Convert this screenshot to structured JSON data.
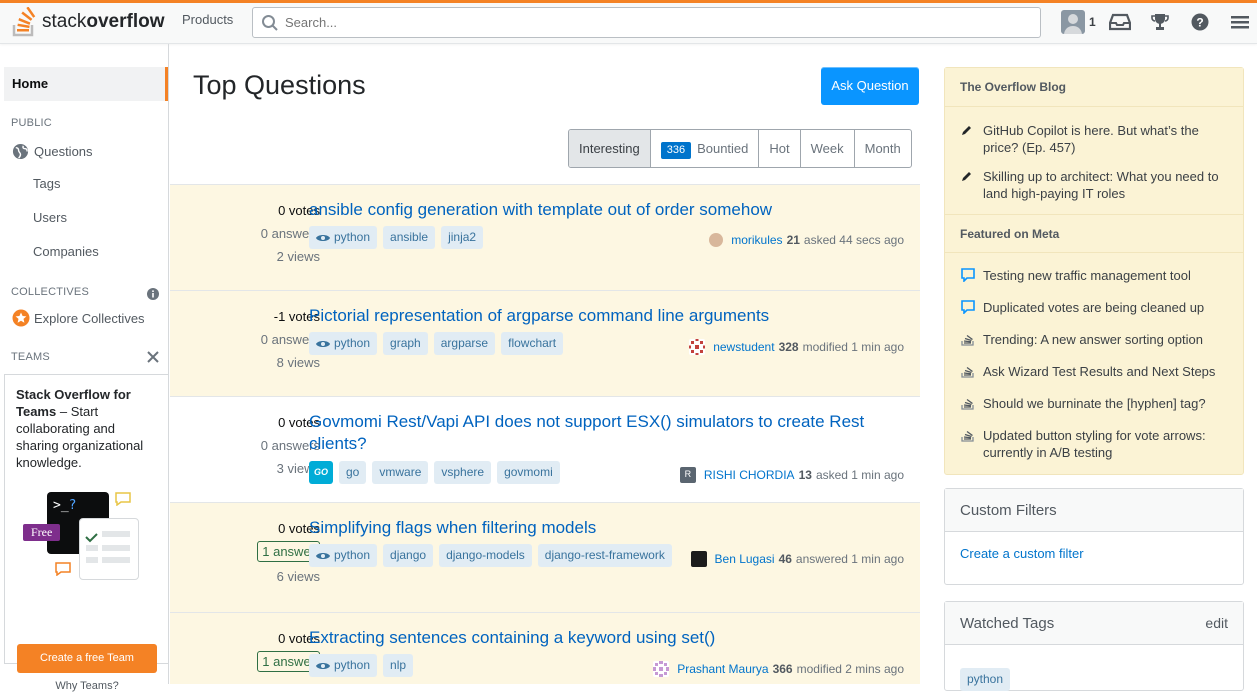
{
  "header": {
    "logo_text_light": "stack",
    "logo_text_bold": "overflow",
    "products": "Products",
    "search_placeholder": "Search...",
    "reputation": "1"
  },
  "sidebar": {
    "home": "Home",
    "public": "PUBLIC",
    "questions": "Questions",
    "tags": "Tags",
    "users": "Users",
    "companies": "Companies",
    "collectives": "COLLECTIVES",
    "explore_collectives": "Explore Collectives",
    "teams": "TEAMS",
    "teams_title": "Stack Overflow for Teams",
    "teams_desc": " – Start collaborating and sharing organizational knowledge.",
    "free_badge": "Free",
    "create_team": "Create a free Team",
    "why_teams": "Why Teams?"
  },
  "main": {
    "title": "Top Questions",
    "ask_button": "Ask Question",
    "filters": [
      {
        "label": "Interesting"
      },
      {
        "label": "Bountied",
        "badge": "336"
      },
      {
        "label": "Hot"
      },
      {
        "label": "Week"
      },
      {
        "label": "Month"
      }
    ],
    "questions": [
      {
        "votes": "0 votes",
        "answers": "0 answers",
        "views": "2 views",
        "title": "ansible config generation with template out of order somehow",
        "tags": [
          "python",
          "ansible",
          "jinja2"
        ],
        "user": "morikules",
        "rep": "21",
        "action": "asked 44 secs ago"
      },
      {
        "votes": "-1 votes",
        "answers": "0 answers",
        "views": "8 views",
        "title": "Pictorial representation of argparse command line arguments",
        "tags": [
          "python",
          "graph",
          "argparse",
          "flowchart"
        ],
        "user": "newstudent",
        "rep": "328",
        "action": "modified 1 min ago"
      },
      {
        "votes": "0 votes",
        "answers": "0 answers",
        "views": "3 views",
        "title": "Govmomi Rest/Vapi API does not support ESX() simulators to create Rest clients?",
        "tags": [
          "go",
          "vmware",
          "vsphere",
          "govmomi"
        ],
        "user": "RISHI CHORDIA",
        "rep": "13",
        "action": "asked 1 min ago",
        "avatar_letter": "R"
      },
      {
        "votes": "0 votes",
        "answers": "1 answer",
        "views": "6 views",
        "title": "Simplifying flags when filtering models",
        "tags": [
          "python",
          "django",
          "django-models",
          "django-rest-framework"
        ],
        "user": "Ben Lugasi",
        "rep": "46",
        "action": "answered 1 min ago"
      },
      {
        "votes": "0 votes",
        "answers": "1 answer",
        "views": "",
        "title": "Extracting sentences containing a keyword using set()",
        "tags": [
          "python",
          "nlp"
        ],
        "user": "Prashant Maurya",
        "rep": "366",
        "action": "modified 2 mins ago"
      }
    ],
    "go_icon_text": "GO"
  },
  "right": {
    "blog_header": "The Overflow Blog",
    "blog_items": [
      "GitHub Copilot is here. But what’s the price? (Ep. 457)",
      "Skilling up to architect: What you need to land high-paying IT roles"
    ],
    "meta_header": "Featured on Meta",
    "meta_items": [
      "Testing new traffic management tool",
      "Duplicated votes are being cleaned up",
      "Trending: A new answer sorting option",
      "Ask Wizard Test Results and Next Steps",
      "Should we burninate the [hyphen] tag?",
      "Updated button styling for vote arrows: currently in A/B testing"
    ],
    "custom_filters": "Custom Filters",
    "create_filter": "Create a custom filter",
    "watched_tags": "Watched Tags",
    "edit": "edit",
    "watched_tag_1": "python"
  },
  "colors": {
    "accent": "#f48225",
    "link": "#0074cc",
    "button": "#0a95ff",
    "highlight": "#fdf7e2"
  }
}
